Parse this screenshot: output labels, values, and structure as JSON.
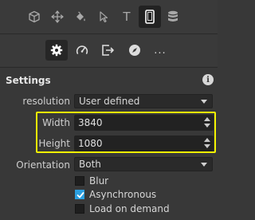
{
  "toolbar_top": {
    "buttons": [
      {
        "name": "cube-icon",
        "active": false
      },
      {
        "name": "move-icon",
        "active": false
      },
      {
        "name": "paint-bucket-icon",
        "active": false
      },
      {
        "name": "cursor-icon",
        "active": false
      },
      {
        "name": "text-icon",
        "active": false,
        "glyph": "T"
      },
      {
        "name": "device-icon",
        "active": true
      },
      {
        "name": "database-icon",
        "active": false
      }
    ]
  },
  "toolbar_second": {
    "buttons": [
      {
        "name": "gear-icon",
        "active": true
      },
      {
        "name": "speedometer-icon",
        "active": false
      },
      {
        "name": "export-icon",
        "active": false
      },
      {
        "name": "compass-icon",
        "active": false
      },
      {
        "name": "more-icon",
        "active": false,
        "glyph": "..."
      }
    ]
  },
  "settings": {
    "title": "Settings",
    "info_glyph": "i",
    "resolution": {
      "label": "resolution",
      "value": "User defined"
    },
    "width": {
      "label": "Width",
      "value": "3840"
    },
    "height": {
      "label": "Height",
      "value": "1080"
    },
    "orientation": {
      "label": "Orientation",
      "value": "Both"
    },
    "options": [
      {
        "label": "Blur",
        "checked": false
      },
      {
        "label": "Asynchronous",
        "checked": true
      },
      {
        "label": "Load on demand",
        "checked": false
      }
    ]
  },
  "colors": {
    "background": "#383838",
    "accent": "#2b9fe0",
    "highlight": "#f2f200"
  }
}
